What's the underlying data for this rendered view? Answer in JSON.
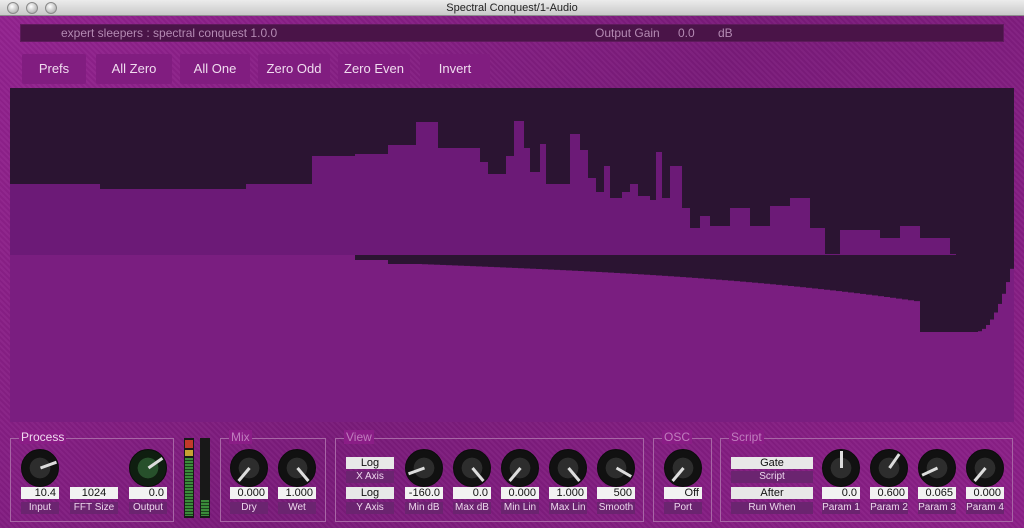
{
  "window": {
    "title": "Spectral Conquest/1-Audio"
  },
  "infobar": {
    "ident": "expert sleepers : spectral conquest 1.0.0",
    "output_gain_label": "Output Gain",
    "output_gain_value": "0.0",
    "output_gain_unit": "dB"
  },
  "toolbar": {
    "prefs": "Prefs",
    "all_zero": "All Zero",
    "all_one": "All One",
    "zero_odd": "Zero Odd",
    "zero_even": "Zero Even",
    "invert": "Invert"
  },
  "colors": {
    "display_bg": "#2b1432",
    "bar_fill": "#6c1a77",
    "bar_fill_lower": "#7a1e80",
    "accent": "#9e2ea6"
  },
  "process": {
    "title": "Process",
    "input_value": "10.4",
    "input_label": "Input",
    "fft_value": "1024",
    "fft_label": "FFT Size",
    "output_value": "0.0",
    "output_label": "Output"
  },
  "mix": {
    "title": "Mix",
    "dry_value": "0.000",
    "dry_label": "Dry",
    "wet_value": "1.000",
    "wet_label": "Wet"
  },
  "view": {
    "title": "View",
    "x_axis_btn": "Log",
    "x_axis_label": "X Axis",
    "y_axis_btn": "Log",
    "y_axis_label": "Y Axis",
    "min_db_value": "-160.0",
    "min_db_label": "Min dB",
    "max_db_value": "0.0",
    "max_db_label": "Max dB",
    "min_lin_value": "0.000",
    "min_lin_label": "Min Lin",
    "max_lin_value": "1.000",
    "max_lin_label": "Max Lin",
    "smooth_value": "500",
    "smooth_label": "Smooth"
  },
  "osc": {
    "title": "OSC",
    "port_value": "Off",
    "port_label": "Port"
  },
  "script": {
    "title": "Script",
    "gate_btn": "Gate",
    "gate_caption": "Script",
    "after_btn": "After",
    "after_caption": "Run When",
    "param1_value": "0.0",
    "param1_label": "Param 1",
    "param2_value": "0.600",
    "param2_label": "Param 2",
    "param3_value": "0.065",
    "param3_label": "Param 3",
    "param4_value": "0.000",
    "param4_label": "Param 4"
  }
}
